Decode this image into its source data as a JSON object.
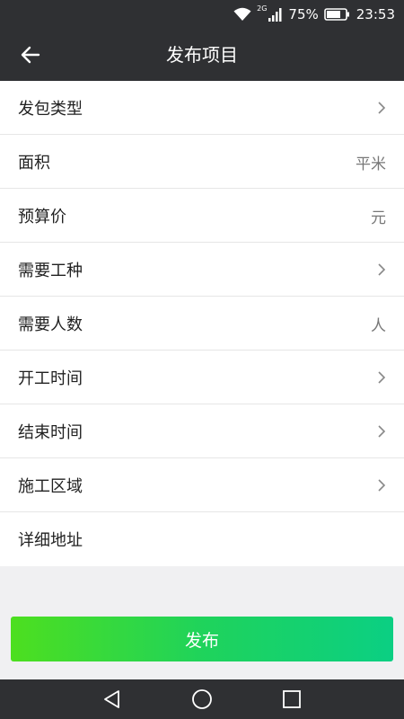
{
  "status_bar": {
    "network": "2G",
    "battery": "75%",
    "time": "23:53",
    "icons": [
      "wifi-icon",
      "signal-icon",
      "battery-icon"
    ]
  },
  "app_bar": {
    "title": "发布项目",
    "back_icon": "arrow-left-icon"
  },
  "form": {
    "rows": [
      {
        "label": "发包类型",
        "right": "",
        "right_icon": "chevron-right-icon"
      },
      {
        "label": "面积",
        "right": "平米",
        "right_icon": ""
      },
      {
        "label": "预算价",
        "right": "元",
        "right_icon": ""
      },
      {
        "label": "需要工种",
        "right": "",
        "right_icon": "chevron-right-icon"
      },
      {
        "label": "需要人数",
        "right": "人",
        "right_icon": ""
      },
      {
        "label": "开工时间",
        "right": "",
        "right_icon": "chevron-right-icon"
      },
      {
        "label": "结束时间",
        "right": "",
        "right_icon": "chevron-right-icon"
      },
      {
        "label": "施工区域",
        "right": "",
        "right_icon": "chevron-right-icon"
      },
      {
        "label": "详细地址",
        "right": "",
        "right_icon": ""
      }
    ]
  },
  "publish_button": {
    "label": "发布"
  },
  "colors": {
    "bar_bg": "#2f3033",
    "button_gradient_start": "#4ddf1f",
    "button_gradient_end": "#0bcf83"
  },
  "nav_bar": {
    "icons": [
      "back-triangle-icon",
      "home-circle-icon",
      "recents-square-icon"
    ]
  }
}
